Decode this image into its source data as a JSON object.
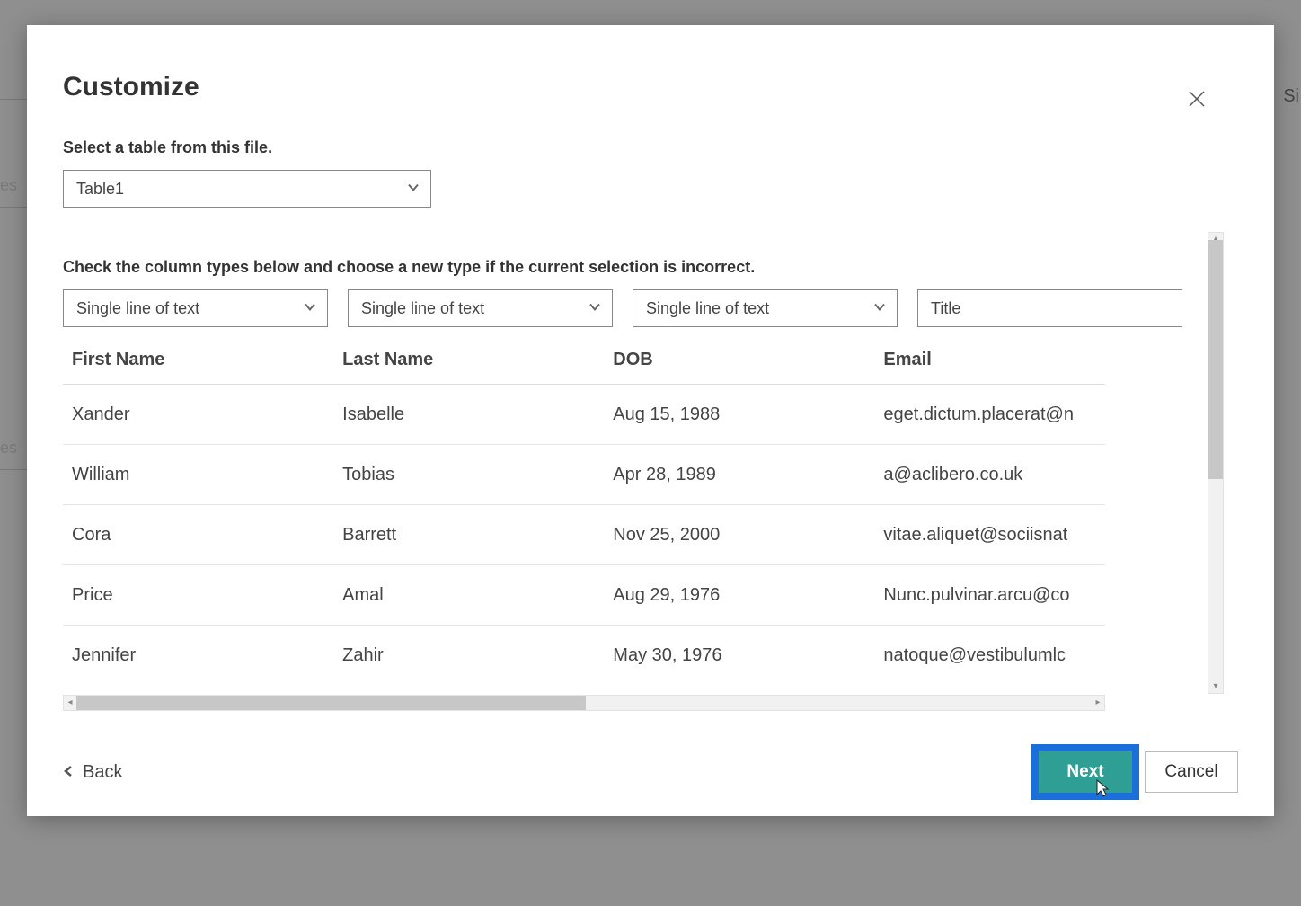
{
  "background_peeks": "es",
  "side_peek": "Si",
  "dialog": {
    "title": "Customize",
    "table_select_label": "Select a table from this file.",
    "table_selected": "Table1",
    "column_type_label": "Check the column types below and choose a new type if the current selection is incorrect.",
    "column_types": [
      "Single line of text",
      "Single line of text",
      "Single line of text",
      "Title"
    ],
    "columns": [
      "First Name",
      "Last Name",
      "DOB",
      "Email"
    ],
    "rows": [
      {
        "first": "Xander",
        "last": "Isabelle",
        "dob": "Aug 15, 1988",
        "email": "eget.dictum.placerat@n"
      },
      {
        "first": "William",
        "last": "Tobias",
        "dob": "Apr 28, 1989",
        "email": "a@aclibero.co.uk"
      },
      {
        "first": "Cora",
        "last": "Barrett",
        "dob": "Nov 25, 2000",
        "email": "vitae.aliquet@sociisnat"
      },
      {
        "first": "Price",
        "last": "Amal",
        "dob": "Aug 29, 1976",
        "email": "Nunc.pulvinar.arcu@co"
      },
      {
        "first": "Jennifer",
        "last": "Zahir",
        "dob": "May 30, 1976",
        "email": "natoque@vestibulumlc"
      }
    ],
    "buttons": {
      "back": "Back",
      "next": "Next",
      "cancel": "Cancel"
    }
  }
}
